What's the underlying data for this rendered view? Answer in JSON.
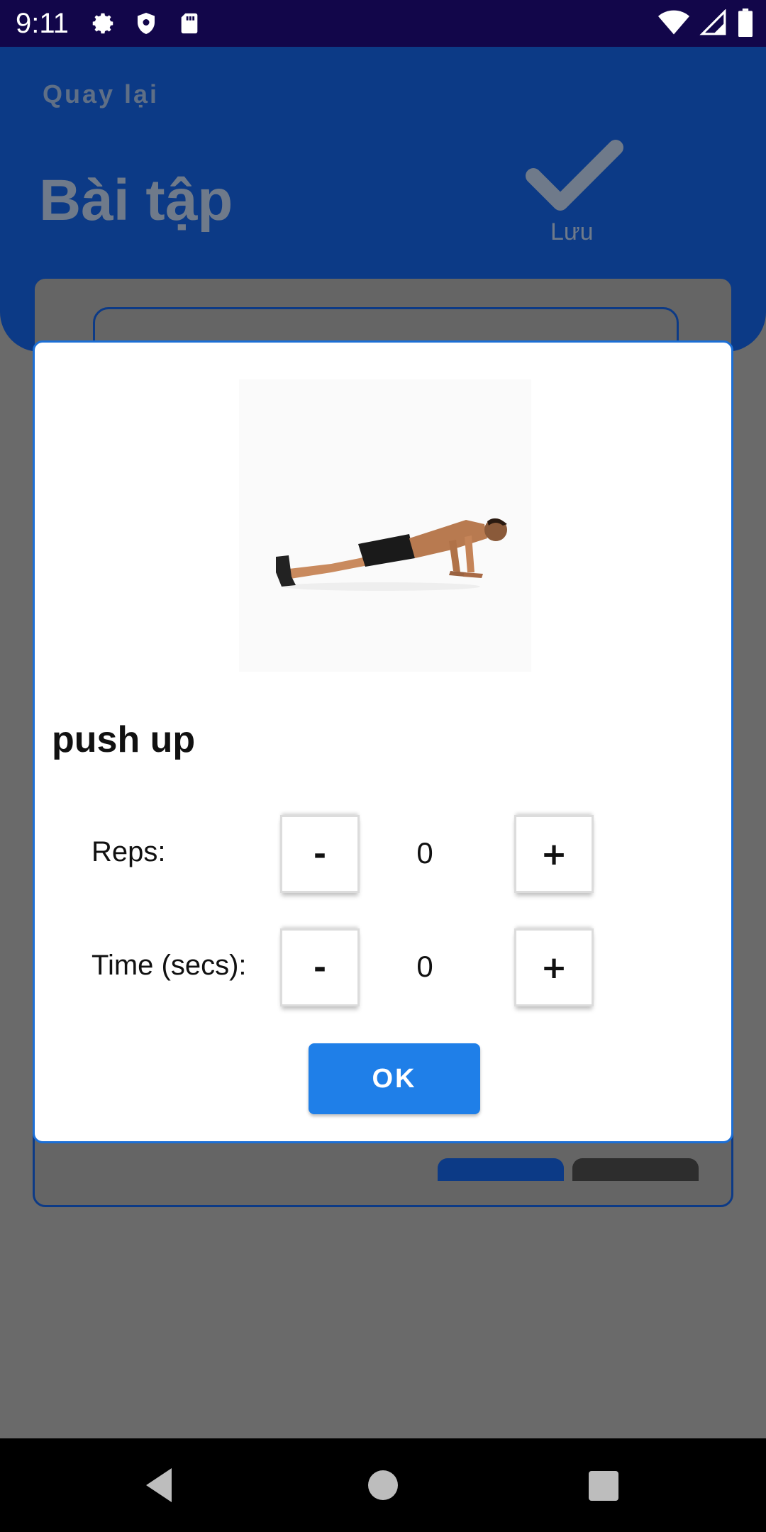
{
  "status_bar": {
    "time": "9:11",
    "left_icons": [
      "gear-icon",
      "shield-icon",
      "sd-card-icon"
    ],
    "right_icons": [
      "wifi-icon",
      "signal-icon",
      "battery-icon"
    ]
  },
  "header": {
    "back_label": "Quay lại",
    "title": "Bài tập",
    "save_label": "Lưu",
    "save_icon": "check-icon"
  },
  "dialog": {
    "exercise_name": "push up",
    "image": "push-up-illustration",
    "rows": [
      {
        "label": "Reps:",
        "minus": "-",
        "value": "0",
        "plus": "+"
      },
      {
        "label": "Time (secs):",
        "minus": "-",
        "value": "0",
        "plus": "+"
      }
    ],
    "ok_label": "OK"
  },
  "nav_bar": {
    "buttons": [
      "back-icon",
      "home-icon",
      "recents-icon"
    ]
  },
  "colors": {
    "status_bar": "#12064a",
    "header": "#0c3a86",
    "scrim": "#6a6a6a",
    "accent": "#1f7fe8",
    "dialog_border": "#1c6fd6"
  }
}
